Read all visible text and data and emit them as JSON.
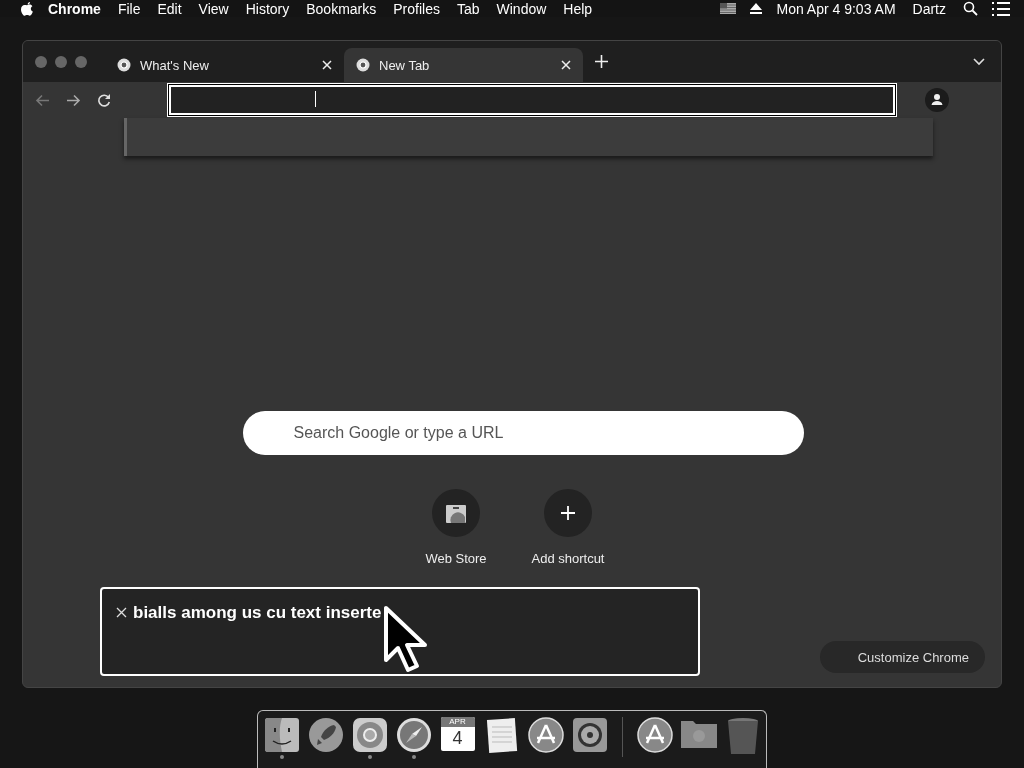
{
  "menubar": {
    "app_name": "Chrome",
    "menus": [
      "File",
      "Edit",
      "View",
      "History",
      "Bookmarks",
      "Profiles",
      "Tab",
      "Window",
      "Help"
    ],
    "clock": "Mon Apr 4  9:03 AM",
    "user": "Dartz"
  },
  "browser": {
    "tabs": [
      {
        "title": "What's New",
        "selected": false
      },
      {
        "title": "New Tab",
        "selected": true
      }
    ],
    "new_tab_page": {
      "search": {
        "placeholder": "Search Google or type a URL"
      },
      "shortcuts": [
        {
          "label": "Web Store",
          "kind": "store"
        },
        {
          "label": "Add shortcut",
          "kind": "add"
        }
      ],
      "customize_button": "Customize Chrome"
    }
  },
  "caption": {
    "text": "bialls among us cu text inserte"
  },
  "dock": {
    "items": [
      {
        "kind": "finder",
        "running": true
      },
      {
        "kind": "launchpad",
        "running": false
      },
      {
        "kind": "chrome",
        "running": true
      },
      {
        "kind": "safari",
        "running": true
      },
      {
        "kind": "calendar",
        "running": false,
        "month": "APR",
        "day": "4"
      },
      {
        "kind": "notes",
        "running": false
      },
      {
        "kind": "appstore",
        "running": false
      },
      {
        "kind": "settings",
        "running": false
      },
      {
        "kind": "divider"
      },
      {
        "kind": "appstore",
        "running": false
      },
      {
        "kind": "folder",
        "running": false
      },
      {
        "kind": "trash",
        "running": false
      }
    ]
  }
}
